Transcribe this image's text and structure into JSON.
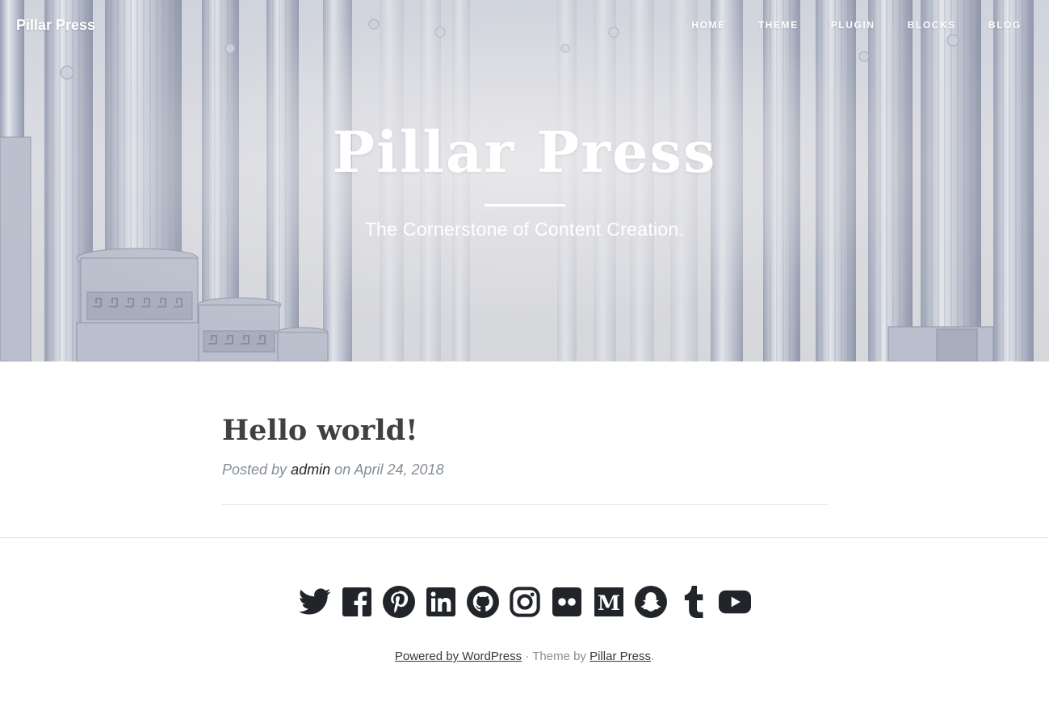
{
  "site": {
    "brand": "Pillar Press",
    "title": "Pillar Press",
    "tagline": "The Cornerstone of Content Creation."
  },
  "nav": {
    "items": [
      {
        "label": "HOME"
      },
      {
        "label": "THEME"
      },
      {
        "label": "PLUGIN"
      },
      {
        "label": "BLOCKS"
      },
      {
        "label": "BLOG"
      }
    ]
  },
  "post": {
    "title": "Hello world!",
    "meta_prefix": "Posted by",
    "author": "admin",
    "meta_on": "on",
    "date": "April 24, 2018"
  },
  "social": {
    "icons": [
      "twitter-icon",
      "facebook-icon",
      "pinterest-icon",
      "linkedin-icon",
      "github-icon",
      "instagram-icon",
      "flickr-icon",
      "medium-icon",
      "snapchat-icon",
      "tumblr-icon",
      "youtube-icon"
    ]
  },
  "footer": {
    "powered_by": "Powered by WordPress",
    "separator": "·",
    "theme_by": "Theme by",
    "theme_author": "Pillar Press",
    "period": "."
  },
  "colors": {
    "hero_tint": "#d9dade",
    "pillar": "#b6bccb",
    "text_dark": "#212529",
    "text_muted": "#868e96"
  }
}
